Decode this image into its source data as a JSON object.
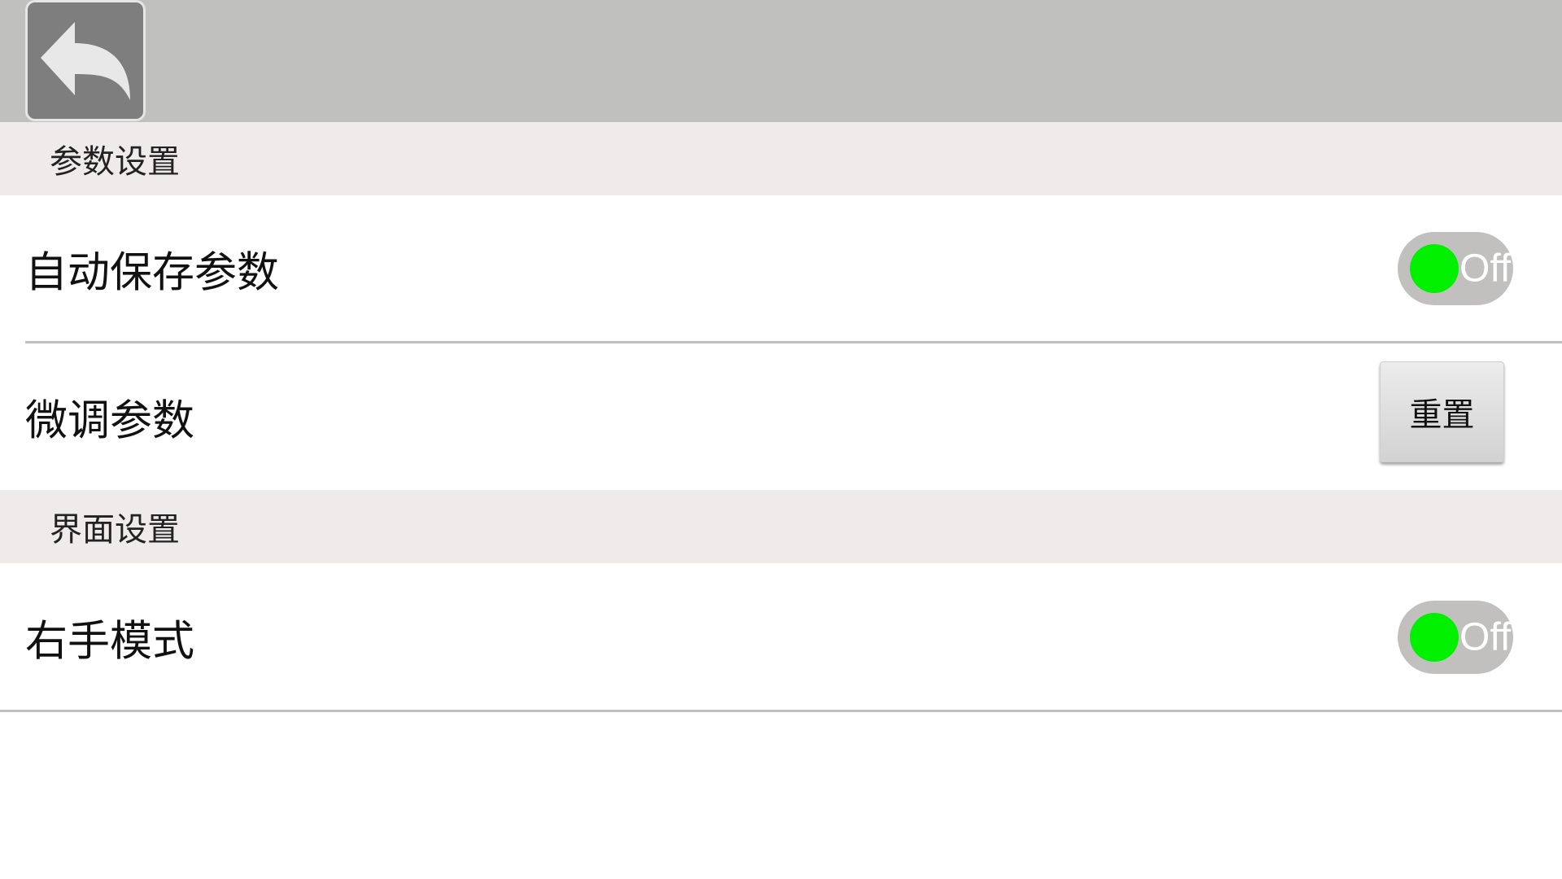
{
  "header": {
    "back_icon": "back-arrow-icon"
  },
  "sections": [
    {
      "title": "参数设置",
      "rows": [
        {
          "label": "自动保存参数",
          "control": "toggle",
          "state": "Off"
        },
        {
          "label": "微调参数",
          "control": "button",
          "button_label": "重置"
        }
      ]
    },
    {
      "title": "界面设置",
      "rows": [
        {
          "label": "右手模式",
          "control": "toggle",
          "state": "Off"
        }
      ]
    }
  ],
  "colors": {
    "toggle_knob": "#00f000",
    "toggle_track": "#c1c0bf",
    "header_bg": "#c0c0be",
    "section_bg": "#eeebea"
  }
}
